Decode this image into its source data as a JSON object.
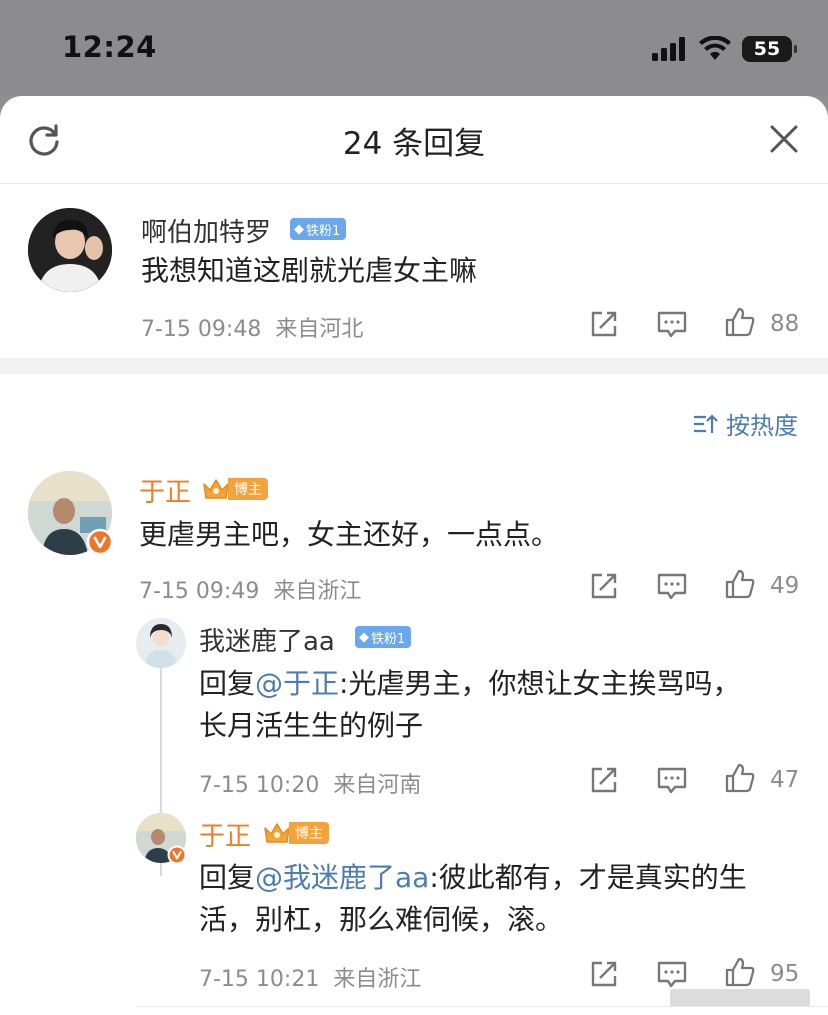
{
  "status_bar": {
    "time": "12:24",
    "battery": "55"
  },
  "header": {
    "title": "24 条回复"
  },
  "main_comment": {
    "username": "啊伯加特罗",
    "badge": "铁粉1",
    "text": "我想知道这剧就光虐女主嘛",
    "time": "7-15 09:48",
    "location": "来自河北",
    "likes": "88"
  },
  "sort": {
    "label": "按热度"
  },
  "replies": [
    {
      "username": "于正",
      "badge": "博主",
      "text": "更虐男主吧，女主还好，一点点。",
      "time": "7-15 09:49",
      "location": "来自浙江",
      "likes": "49"
    },
    {
      "username": "我迷鹿了aa",
      "badge": "铁粉1",
      "reply_prefix": "回复",
      "mention": "@于正",
      "text_line1": ":光虐男主，你想让女主挨骂吗，",
      "text_line2": "长月活生生的例子",
      "time": "7-15 10:20",
      "location": "来自河南",
      "likes": "47"
    },
    {
      "username": "于正",
      "badge": "博主",
      "reply_prefix": "回复",
      "mention": "@我迷鹿了aa",
      "text_line1": ":彼此都有，才是真实的生",
      "text_line2": "活，别杠，那么难伺候，滚。",
      "time": "7-15 10:21",
      "location": "来自浙江",
      "likes": "95"
    }
  ],
  "colors": {
    "accent": "#4b7db5",
    "blogger": "#f27c25",
    "fan_badge": "#6aa7ec"
  },
  "icons": [
    "refresh-icon",
    "close-icon",
    "share-icon",
    "comment-icon",
    "like-icon",
    "sort-icon",
    "verified-icon",
    "crown-icon",
    "diamond-icon"
  ]
}
